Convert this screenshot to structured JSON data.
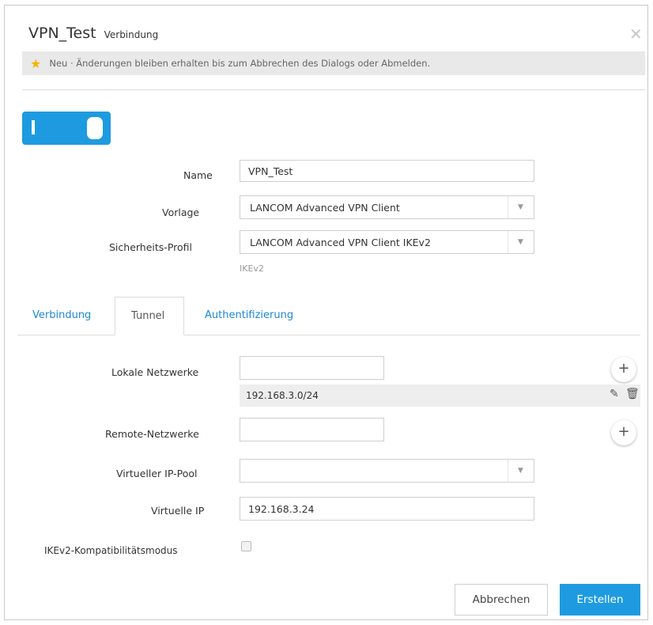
{
  "dialog": {
    "title": "VPN_Test",
    "subtitle": "Verbindung",
    "close_glyph": "✕",
    "notice": "Neu · Änderungen bleiben erhalten bis zum Abbrechen des Dialogs oder Abmelden.",
    "notice_icon": "star-icon",
    "toggle_state": "on"
  },
  "form": {
    "name_label": "Name",
    "name_value": "VPN_Test",
    "vorlage_label": "Vorlage",
    "vorlage_value": "LANCOM Advanced VPN Client",
    "profil_label": "Sicherheits-Profil",
    "profil_value": "LANCOM Advanced VPN Client IKEv2",
    "profil_hint": "IKEv2"
  },
  "tabs": [
    {
      "label": "Verbindung",
      "active": false
    },
    {
      "label": "Tunnel",
      "active": true
    },
    {
      "label": "Authentifizierung",
      "active": false
    }
  ],
  "tunnel": {
    "lokale_label": "Lokale Netzwerke",
    "lokale_input": "",
    "lokale_entries": [
      "192.168.3.0/24"
    ],
    "remote_label": "Remote-Netzwerke",
    "remote_input": "",
    "pool_label": "Virtueller IP-Pool",
    "pool_value": "",
    "vip_label": "Virtuelle IP",
    "vip_value": "192.168.3.24",
    "ikev2_label": "IKEv2-Kompatibilitätsmodus",
    "ikev2_checked": false,
    "add_glyph": "+"
  },
  "buttons": {
    "cancel": "Abbrechen",
    "create": "Erstellen"
  }
}
